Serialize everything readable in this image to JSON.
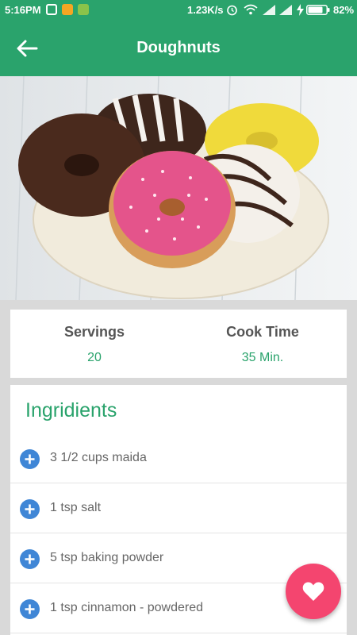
{
  "status_bar": {
    "time": "5:16PM",
    "network_speed": "1.23K/s",
    "battery": "82%",
    "icons": [
      "vpn-icon",
      "notification-app-icon",
      "android-icon",
      "alarm-icon",
      "wifi-icon",
      "signal-icon",
      "signal-icon",
      "charging-icon",
      "battery-icon"
    ]
  },
  "app_bar": {
    "title": "Doughnuts",
    "back_icon": "arrow-left-icon"
  },
  "hero": {
    "description_icon": "doughnuts-photo"
  },
  "info": {
    "servings_label": "Servings",
    "servings_value": "20",
    "cook_time_label": "Cook Time",
    "cook_time_value": "35 Min."
  },
  "ingredients": {
    "title": "Ingridients",
    "items": [
      {
        "text": "3 1/2 cups maida"
      },
      {
        "text": "1 tsp salt"
      },
      {
        "text": "5 tsp baking powder"
      },
      {
        "text": "1 tsp cinnamon - powdered"
      }
    ]
  },
  "fab": {
    "icon": "heart-icon"
  },
  "colors": {
    "primary": "#2aa36c",
    "fab": "#f4456f",
    "plus_icon": "#3f86d6"
  }
}
